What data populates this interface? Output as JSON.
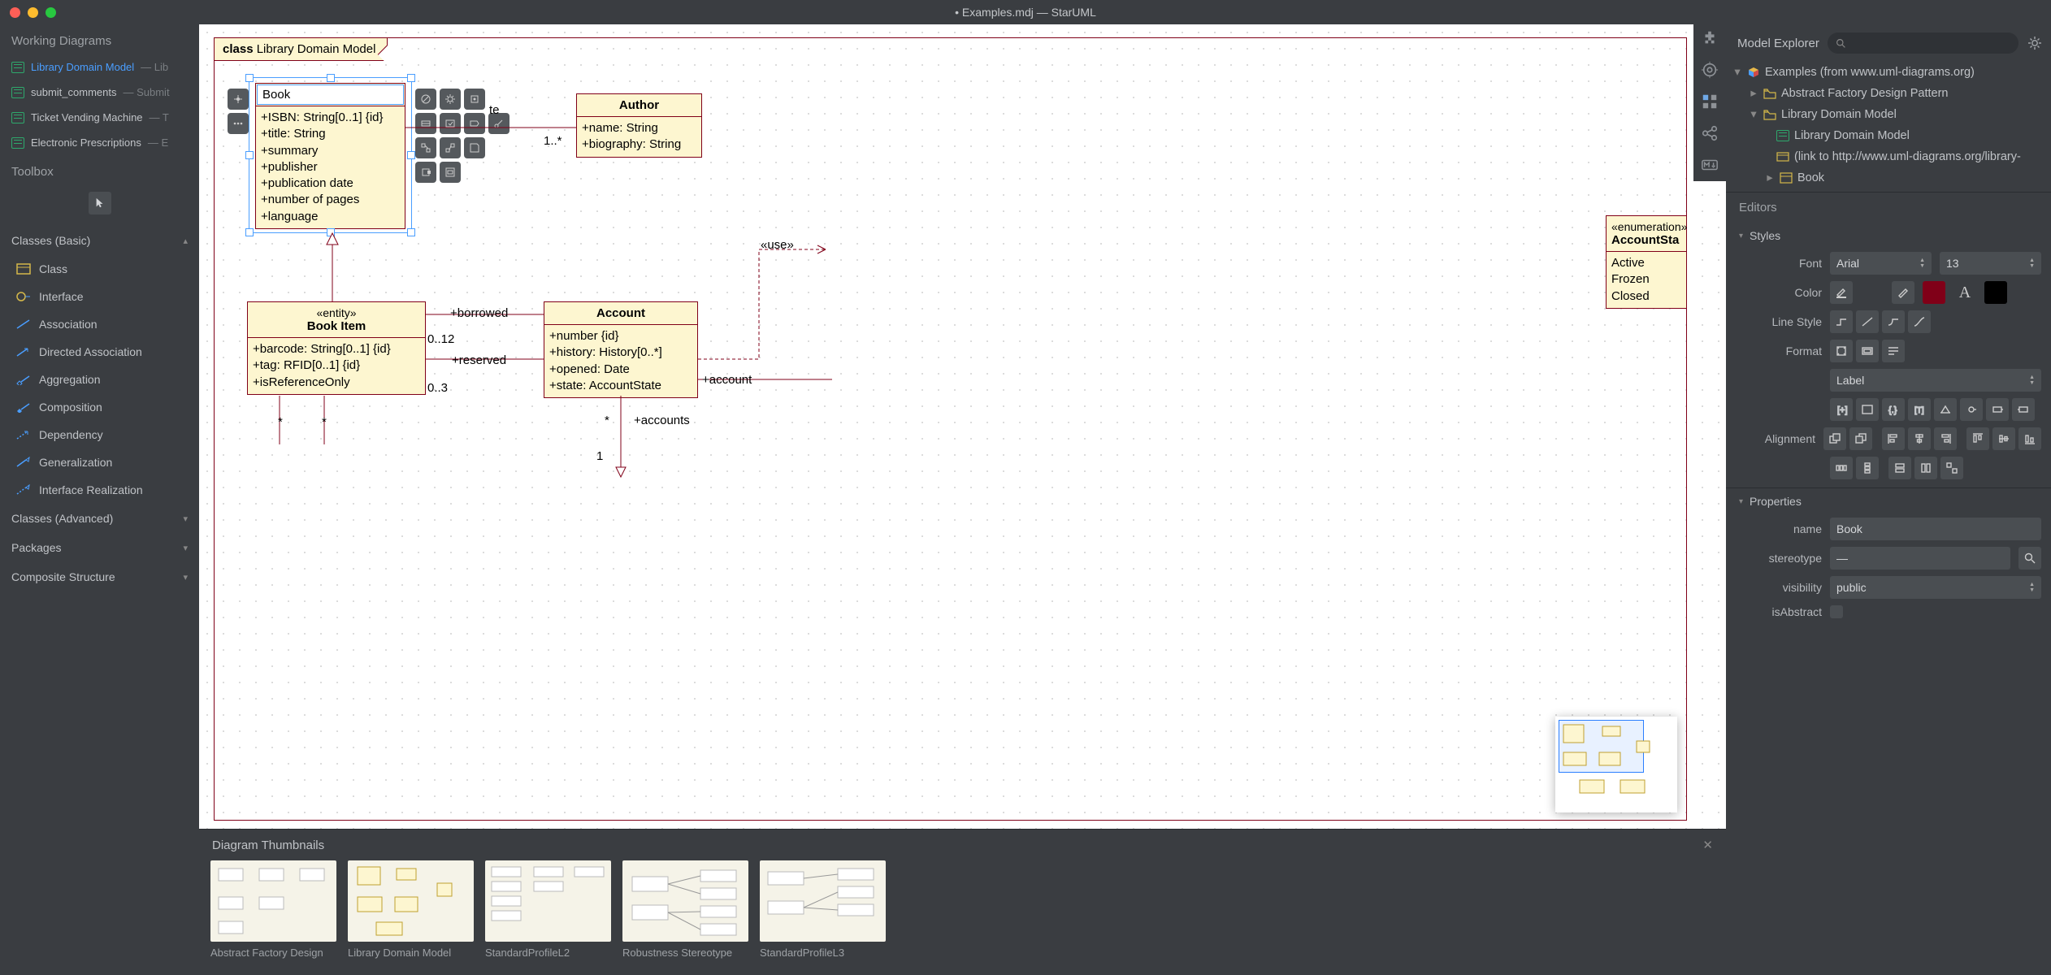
{
  "title": "• Examples.mdj — StarUML",
  "left": {
    "workingDiagrams": "Working Diagrams",
    "items": [
      {
        "label": "Library Domain Model",
        "sub": "— Lib"
      },
      {
        "label": "submit_comments",
        "sub": "— Submit"
      },
      {
        "label": "Ticket Vending Machine",
        "sub": "— T"
      },
      {
        "label": "Electronic Prescriptions",
        "sub": "— E"
      }
    ],
    "toolbox": "Toolbox",
    "catBasic": "Classes (Basic)",
    "tools": [
      "Class",
      "Interface",
      "Association",
      "Directed Association",
      "Aggregation",
      "Composition",
      "Dependency",
      "Generalization",
      "Interface Realization"
    ],
    "catAdv": "Classes (Advanced)",
    "catPkg": "Packages",
    "catComp": "Composite Structure"
  },
  "canvas": {
    "frameKind": "class",
    "frameName": "Library Domain Model",
    "editValue": "Book",
    "book": {
      "attrs": [
        "+ISBN: String[0..1] {id}",
        "+title: String",
        "+summary",
        "+publisher",
        "+publication date",
        "+number of pages",
        "+language"
      ]
    },
    "author": {
      "name": "Author",
      "attrs": [
        "+name: String",
        "+biography: String"
      ]
    },
    "bookItem": {
      "stereo": "«entity»",
      "name": "Book Item",
      "attrs": [
        "+barcode: String[0..1] {id}",
        "+tag: RFID[0..1] {id}",
        "+isReferenceOnly"
      ]
    },
    "account": {
      "name": "Account",
      "attrs": [
        "+number {id}",
        "+history: History[0..*]",
        "+opened: Date",
        "+state: AccountState"
      ]
    },
    "enum": {
      "stereo": "«enumeration»",
      "name": "AccountSta",
      "vals": [
        "Active",
        "Frozen",
        "Closed"
      ]
    },
    "labels": {
      "wrote": "te",
      "oneMany": "1..*",
      "use": "«use»",
      "borrowed": "+borrowed",
      "b012": "0..12",
      "reserved": "+reserved",
      "r03": "0..3",
      "star1": "*",
      "star2": "*",
      "star3": "*",
      "accounts": "+accounts",
      "account": "+account",
      "one": "1"
    }
  },
  "thumbs": {
    "header": "Diagram Thumbnails",
    "items": [
      "Abstract Factory Design",
      "Library Domain Model",
      "StandardProfileL2",
      "Robustness Stereotype",
      "StandardProfileL3"
    ]
  },
  "right": {
    "explorer": "Model Explorer",
    "tree": {
      "root": "Examples (from www.uml-diagrams.org)",
      "n1": "Abstract Factory Design Pattern",
      "n2": "Library Domain Model",
      "n2a": "Library Domain Model",
      "n2b": "(link to http://www.uml-diagrams.org/library-",
      "n2c": "Book"
    },
    "editors": "Editors",
    "styles": "Styles",
    "font": "Font",
    "fontVal": "Arial",
    "fontSize": "13",
    "color": "Color",
    "fillColor": "#fdf6d0",
    "lineColor": "#800018",
    "textColor": "#000000",
    "lineStyle": "Line Style",
    "format": "Format",
    "formatVal": "Label",
    "alignment": "Alignment",
    "properties": "Properties",
    "name": "name",
    "nameVal": "Book",
    "stereotype": "stereotype",
    "stereoVal": "—",
    "visibility": "visibility",
    "visVal": "public",
    "isAbstract": "isAbstract"
  }
}
